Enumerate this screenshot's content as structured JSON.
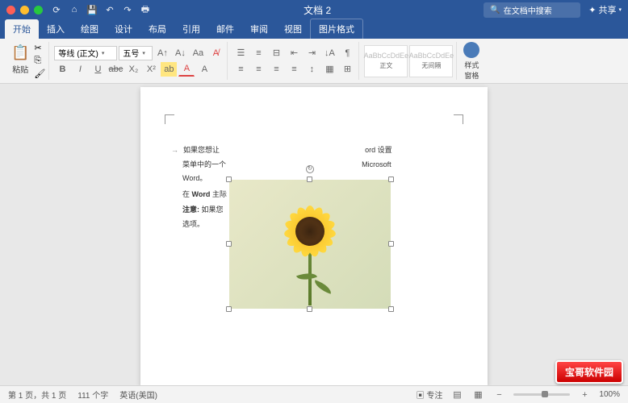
{
  "window": {
    "title": "文档 2",
    "search_placeholder": "在文档中搜索",
    "share_label": "共享"
  },
  "tabs": [
    {
      "label": "开始",
      "active": true
    },
    {
      "label": "插入"
    },
    {
      "label": "绘图"
    },
    {
      "label": "设计"
    },
    {
      "label": "布局"
    },
    {
      "label": "引用"
    },
    {
      "label": "邮件"
    },
    {
      "label": "审阅"
    },
    {
      "label": "视图"
    },
    {
      "label": "图片格式",
      "context": true
    }
  ],
  "ribbon": {
    "paste_label": "粘贴",
    "font_name": "等线 (正文)",
    "font_size": "五号",
    "styles": [
      {
        "preview": "AaBbCcDdEe",
        "label": "正文"
      },
      {
        "preview": "AaBbCcDdEe",
        "label": "无间隔"
      }
    ],
    "pane_label": "样式\n窗格"
  },
  "document": {
    "line1_pre": "如果您想让",
    "line1_mid": "",
    "line1_post": "ord 设置",
    "line2": "菜单中的一个",
    "line2_end": "Microsoft",
    "line3": "Word。",
    "line4_pre": "在 ",
    "line4_bold": "Word",
    "line4_post": " 主际",
    "line5_bold": "注意:",
    "line5_post": " 如果您",
    "line5_end": "\"选项\"",
    "line6": "选项。"
  },
  "status": {
    "page": "第 1 页，共 1 页",
    "words": "111 个字",
    "lang": "英语(美国)",
    "focus": "专注",
    "zoom": "100%"
  },
  "watermark": "宝哥软件园"
}
